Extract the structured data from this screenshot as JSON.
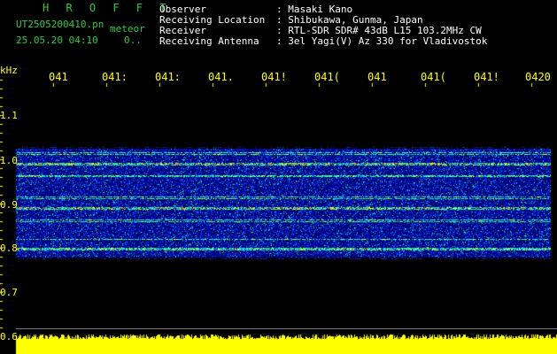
{
  "header": {
    "title": "H R O F F T",
    "filename": "UT2505200410.pn",
    "mode": "meteor",
    "datetime": "25.05.20 04:10",
    "counter": "0..",
    "labels": [
      "Observer",
      "Receiving Location",
      "Receiver",
      "Receiving Antenna"
    ],
    "values": [
      ": Masaki Kano",
      ": Shibukawa, Gunma, Japan",
      ": RTL-SDR SDR# 43dB L15 103.2MHz CW",
      ": 3el Yagi(V) Az 330 for Vladivostok"
    ]
  },
  "axis": {
    "unit": "kHz",
    "y_ticks": [
      "1.1",
      "1.0",
      "0.9",
      "0.8",
      "0.7",
      "0.6"
    ],
    "x_ticks": [
      "041",
      "041:",
      "041:",
      "041.",
      "041!",
      "041(",
      "041",
      "041(",
      "041!",
      "0420"
    ]
  },
  "colors": {
    "text_green": "#2ecc40",
    "text_white": "#ffffff",
    "axis_yellow": "#ffff00",
    "signal_bg": "#000060"
  }
}
